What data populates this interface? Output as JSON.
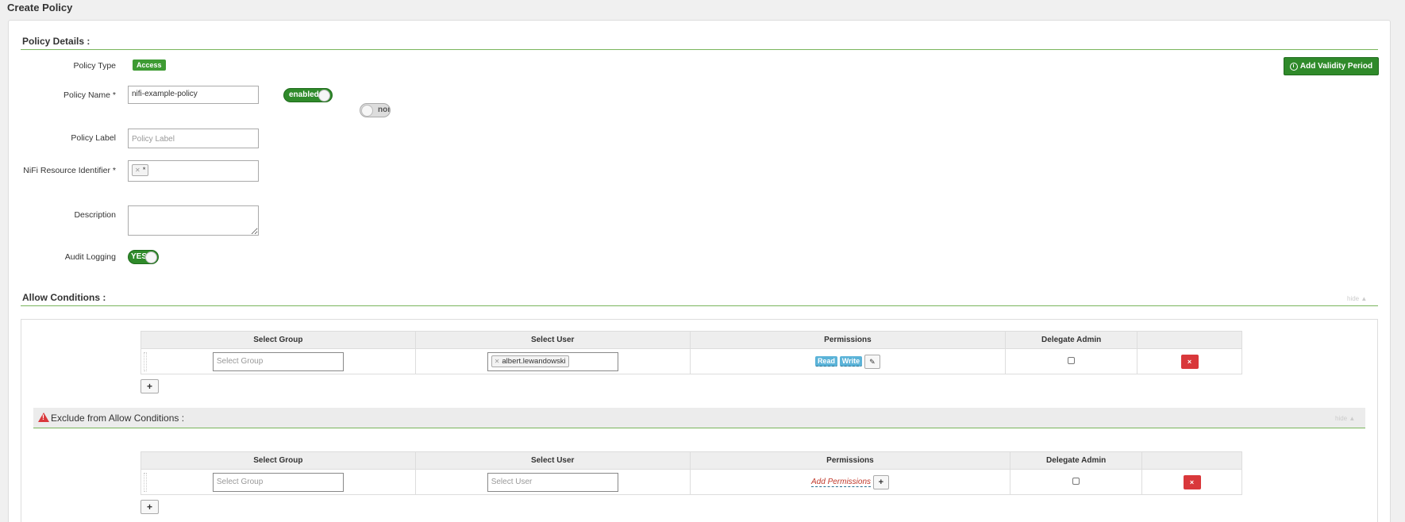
{
  "page": {
    "title": "Create Policy"
  },
  "details": {
    "section_title": "Policy Details :",
    "policy_type_label": "Policy Type",
    "policy_type_value": "Access",
    "policy_name_label": "Policy Name *",
    "policy_name_value": "nifi-example-policy",
    "enabled_toggle": "enabled",
    "override_toggle": "nor",
    "policy_label_label": "Policy Label",
    "policy_label_placeholder": "Policy Label",
    "resource_label": "NiFi Resource Identifier *",
    "resource_tag": "*",
    "description_label": "Description",
    "audit_label": "Audit Logging",
    "audit_toggle": "YES",
    "add_validity_button": "Add Validity Period"
  },
  "allow": {
    "section_title": "Allow Conditions :",
    "hide_link": "hide ▲",
    "columns": [
      "Select Group",
      "Select User",
      "Permissions",
      "Delegate Admin",
      ""
    ],
    "row": {
      "group_placeholder": "Select Group",
      "user_tag": "albert.lewandowski",
      "permissions": [
        "Read",
        "Write"
      ],
      "delete_button": "×"
    },
    "add_button": "+"
  },
  "exclude": {
    "section_title": "Exclude from Allow Conditions :",
    "hide_link": "hide ▲",
    "columns": [
      "Select Group",
      "Select User",
      "Permissions",
      "Delegate Admin",
      ""
    ],
    "row": {
      "group_placeholder": "Select Group",
      "user_placeholder": "Select User",
      "add_permissions": "Add Permissions",
      "delete_button": "×"
    },
    "add_button": "+"
  },
  "colors": {
    "green": "#2f8a2a",
    "red": "#d9383b",
    "info": "#5bb3d8"
  }
}
